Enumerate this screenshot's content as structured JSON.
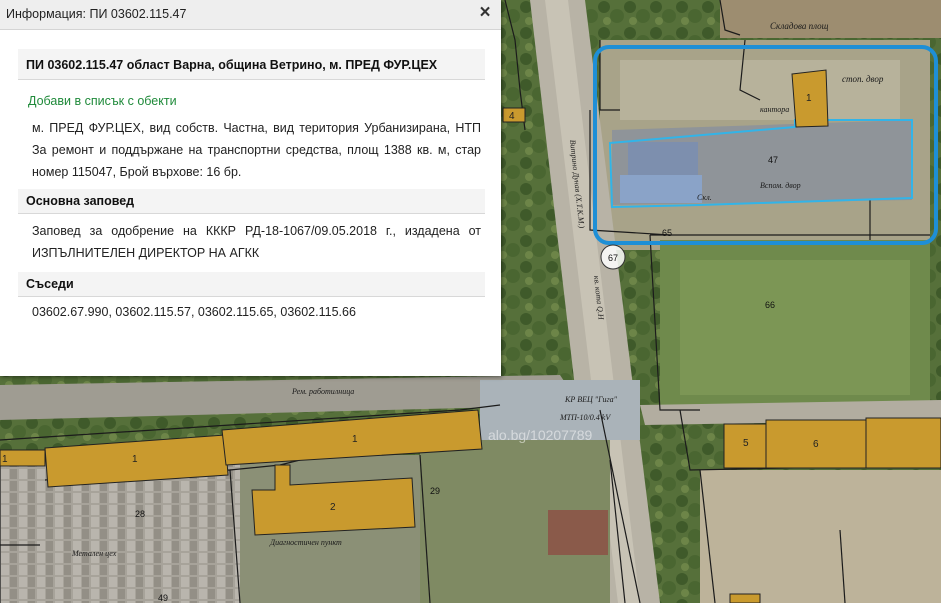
{
  "info_panel": {
    "title": "Информация: ПИ 03602.115.47",
    "close_label": "×",
    "parcel_heading": "ПИ 03602.115.47 област Варна, община Ветрино, м. ПРЕД ФУР.ЦЕХ",
    "add_link_label": "Добави в списък с обекти",
    "description": "м. ПРЕД ФУР.ЦЕХ, вид собств. Частна, вид територия Урбанизирана, НТП За ремонт и поддържане на транспортни средства, площ 1388 кв. м, стар номер 115047, Брой върхове: 16 бр.",
    "order_heading": "Основна заповед",
    "order_text": "Заповед за одобрение на КККР РД-18-1067/09.05.2018 г., издадена от ИЗПЪЛНИТЕЛЕН ДИРЕКТОР НА АГКК",
    "neighbors_heading": "Съседи",
    "neighbors_text": "03602.67.990, 03602.115.57, 03602.115.65, 03602.115.66"
  },
  "map": {
    "labels": {
      "skladova_plosht": "Складова площ",
      "stop_dvor": "стоп. двор",
      "kantora": "канторa",
      "skl": "Скл.",
      "vs_dvor": "Вспом. двор",
      "road_name": "Витрино Дунав (Х.Т.К.М.)",
      "kv_label": "кв. кота Q.H",
      "rem_rabotilnica": "Рем. работилница",
      "kr_vec": "КР ВЕЦ \"Гига\"",
      "mtp_label": "МТП-10/0.4 kV",
      "metalen_ceh": "Метален цех",
      "diagnostichen_punkt": "Диагностичен пункт",
      "watermark": "alo.bg/10207789"
    },
    "parcel_numbers": {
      "p4": "4",
      "p47": "47",
      "p65": "65",
      "p66": "66",
      "p67": "67",
      "p1_top": "1",
      "p1_left": "1",
      "p1_mid": "1",
      "p1_edge": "1",
      "p2": "2",
      "p5": "5",
      "p6": "6",
      "p28": "28",
      "p29": "29",
      "p49": "49"
    },
    "colors": {
      "building": "#c99a2e",
      "selection": "#1e8fd6",
      "parcel_line": "#1b1b1b",
      "parcel_selected": "#32b4e8",
      "add_link": "#1f8a3a"
    }
  }
}
